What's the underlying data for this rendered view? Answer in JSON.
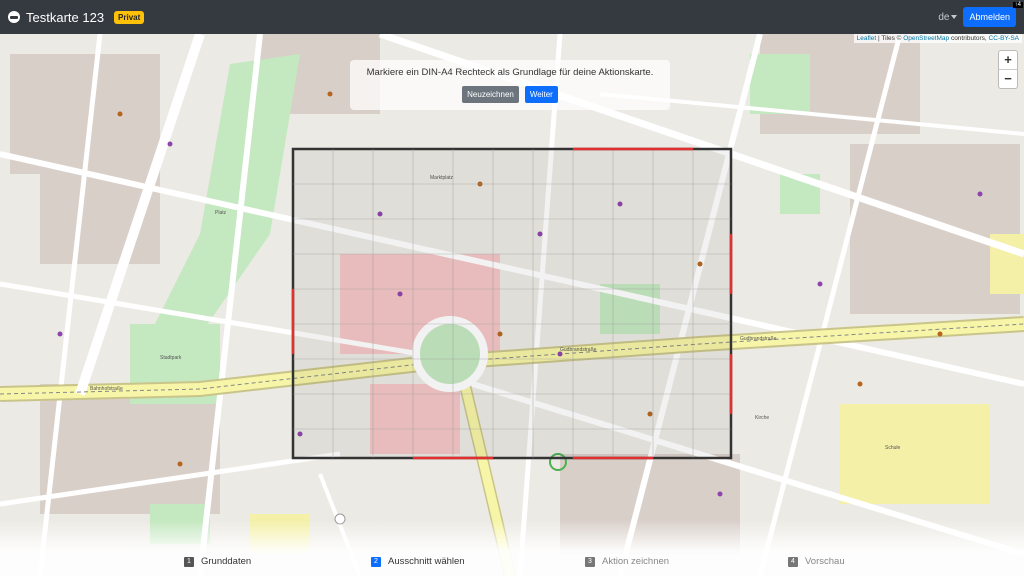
{
  "navbar": {
    "title": "Testkarte 123",
    "badge": "Privat",
    "language": "de",
    "logout_label": "Abmelden",
    "corner_badge": "↑4"
  },
  "map": {
    "attribution": {
      "leaflet": "Leaflet",
      "tiles_prefix": " | Tiles © ",
      "osm": "OpenStreetMap",
      "contributors": " contributors, ",
      "license": "CC-BY-SA"
    },
    "zoom_in": "+",
    "zoom_out": "−",
    "labels": {
      "street_1": "Gudbrandstraße",
      "street_2": "Gudbrandstraße",
      "street_3": "Bahnhofstraße",
      "park": "Stadtpark",
      "place": "Marktplatz",
      "square": "Platz",
      "church": "Kirche",
      "school": "Schule"
    }
  },
  "instruction": {
    "text": "Markiere ein DIN-A4 Rechteck als Grundlage für deine Aktionskarte.",
    "redraw_label": "Neuzeichnen",
    "next_label": "Weiter"
  },
  "steps": [
    {
      "number": "1",
      "label": "Grunddaten"
    },
    {
      "number": "2",
      "label": "Ausschnitt wählen"
    },
    {
      "number": "3",
      "label": "Aktion zeichnen"
    },
    {
      "number": "4",
      "label": "Vorschau"
    }
  ],
  "colors": {
    "navbar": "#343a40",
    "primary": "#0d6efd",
    "badge": "#ffc107",
    "major_road": "#f7f5a7",
    "selection_frame": "#333333",
    "selection_accent": "#e03030"
  }
}
